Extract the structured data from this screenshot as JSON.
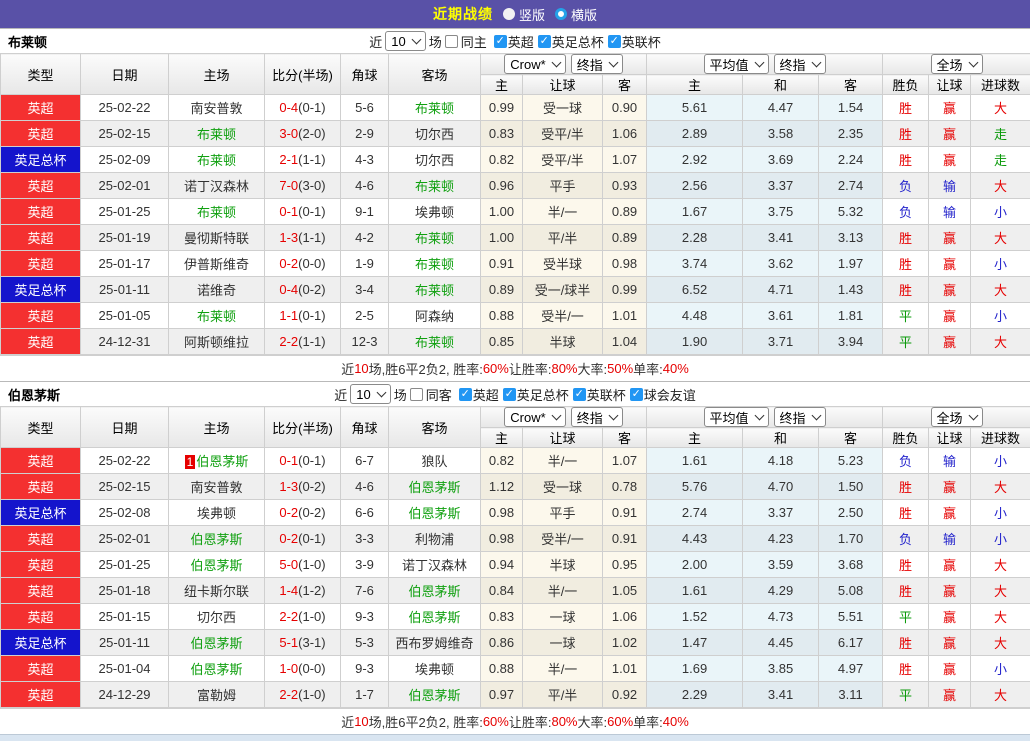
{
  "topbar": {
    "title": "近期战绩",
    "vertical_label": "竖版",
    "horizontal_label": "横版"
  },
  "labels": {
    "near": "近",
    "games": "场",
    "col_type": "类型",
    "col_date": "日期",
    "col_home": "主场",
    "col_score": "比分(半场)",
    "col_corner": "角球",
    "col_away": "客场",
    "col_host": "主",
    "col_handicap": "让球",
    "col_guest": "客",
    "col_draw": "和",
    "col_result": "胜负",
    "col_let": "让球",
    "col_goals": "进球数",
    "sel_crow": "Crow*",
    "sel_final": "终指",
    "sel_avg": "平均值",
    "sel_full": "全场"
  },
  "colors": {
    "topbar_bg": "#5951A7",
    "title_yellow": "#FFFF00",
    "badge_red": "#F43030",
    "badge_blue": "#1414CC",
    "team_green": "#0FA00F",
    "score_red": "#E60000",
    "res_red": "#E60000",
    "res_blue": "#2424CC",
    "res_green": "#089908",
    "checkbox_blue": "#2196F3",
    "radio_ring_blue": "#25A2E8"
  },
  "sections": [
    {
      "team": "布莱顿",
      "filter": {
        "count": "10",
        "same_label": "同主",
        "same_checked": false,
        "leagues": [
          "英超",
          "英足总杯",
          "英联杯"
        ]
      },
      "rows": [
        {
          "lg": "英超",
          "lgc": "red",
          "date": "25-02-22",
          "home": "南安普敦",
          "hg": false,
          "badge": "",
          "score": "0-4",
          "half": "(0-1)",
          "cor": "5-6",
          "away": "布莱顿",
          "ag": true,
          "odds": [
            "0.99",
            "受一球",
            "0.90"
          ],
          "avg": [
            "5.61",
            "4.47",
            "1.54"
          ],
          "res": [
            [
              "胜",
              "r"
            ],
            [
              "赢",
              "r"
            ],
            [
              "大",
              "r"
            ]
          ]
        },
        {
          "lg": "英超",
          "lgc": "red",
          "date": "25-02-15",
          "home": "布莱顿",
          "hg": true,
          "badge": "",
          "score": "3-0",
          "half": "(2-0)",
          "cor": "2-9",
          "away": "切尔西",
          "ag": false,
          "odds": [
            "0.83",
            "受平/半",
            "1.06"
          ],
          "avg": [
            "2.89",
            "3.58",
            "2.35"
          ],
          "res": [
            [
              "胜",
              "r"
            ],
            [
              "赢",
              "r"
            ],
            [
              "走",
              "g"
            ]
          ]
        },
        {
          "lg": "英足总杯",
          "lgc": "blue",
          "date": "25-02-09",
          "home": "布莱顿",
          "hg": true,
          "badge": "",
          "score": "2-1",
          "half": "(1-1)",
          "cor": "4-3",
          "away": "切尔西",
          "ag": false,
          "odds": [
            "0.82",
            "受平/半",
            "1.07"
          ],
          "avg": [
            "2.92",
            "3.69",
            "2.24"
          ],
          "res": [
            [
              "胜",
              "r"
            ],
            [
              "赢",
              "r"
            ],
            [
              "走",
              "g"
            ]
          ]
        },
        {
          "lg": "英超",
          "lgc": "red",
          "date": "25-02-01",
          "home": "诺丁汉森林",
          "hg": false,
          "badge": "",
          "score": "7-0",
          "half": "(3-0)",
          "cor": "4-6",
          "away": "布莱顿",
          "ag": true,
          "odds": [
            "0.96",
            "平手",
            "0.93"
          ],
          "avg": [
            "2.56",
            "3.37",
            "2.74"
          ],
          "res": [
            [
              "负",
              "b"
            ],
            [
              "输",
              "b"
            ],
            [
              "大",
              "r"
            ]
          ]
        },
        {
          "lg": "英超",
          "lgc": "red",
          "date": "25-01-25",
          "home": "布莱顿",
          "hg": true,
          "badge": "",
          "score": "0-1",
          "half": "(0-1)",
          "cor": "9-1",
          "away": "埃弗顿",
          "ag": false,
          "odds": [
            "1.00",
            "半/一",
            "0.89"
          ],
          "avg": [
            "1.67",
            "3.75",
            "5.32"
          ],
          "res": [
            [
              "负",
              "b"
            ],
            [
              "输",
              "b"
            ],
            [
              "小",
              "b"
            ]
          ]
        },
        {
          "lg": "英超",
          "lgc": "red",
          "date": "25-01-19",
          "home": "曼彻斯特联",
          "hg": false,
          "badge": "",
          "score": "1-3",
          "half": "(1-1)",
          "cor": "4-2",
          "away": "布莱顿",
          "ag": true,
          "odds": [
            "1.00",
            "平/半",
            "0.89"
          ],
          "avg": [
            "2.28",
            "3.41",
            "3.13"
          ],
          "res": [
            [
              "胜",
              "r"
            ],
            [
              "赢",
              "r"
            ],
            [
              "大",
              "r"
            ]
          ]
        },
        {
          "lg": "英超",
          "lgc": "red",
          "date": "25-01-17",
          "home": "伊普斯维奇",
          "hg": false,
          "badge": "",
          "score": "0-2",
          "half": "(0-0)",
          "cor": "1-9",
          "away": "布莱顿",
          "ag": true,
          "odds": [
            "0.91",
            "受半球",
            "0.98"
          ],
          "avg": [
            "3.74",
            "3.62",
            "1.97"
          ],
          "res": [
            [
              "胜",
              "r"
            ],
            [
              "赢",
              "r"
            ],
            [
              "小",
              "b"
            ]
          ]
        },
        {
          "lg": "英足总杯",
          "lgc": "blue",
          "date": "25-01-11",
          "home": "诺维奇",
          "hg": false,
          "badge": "",
          "score": "0-4",
          "half": "(0-2)",
          "cor": "3-4",
          "away": "布莱顿",
          "ag": true,
          "odds": [
            "0.89",
            "受一/球半",
            "0.99"
          ],
          "avg": [
            "6.52",
            "4.71",
            "1.43"
          ],
          "res": [
            [
              "胜",
              "r"
            ],
            [
              "赢",
              "r"
            ],
            [
              "大",
              "r"
            ]
          ]
        },
        {
          "lg": "英超",
          "lgc": "red",
          "date": "25-01-05",
          "home": "布莱顿",
          "hg": true,
          "badge": "",
          "score": "1-1",
          "half": "(0-1)",
          "cor": "2-5",
          "away": "阿森纳",
          "ag": false,
          "odds": [
            "0.88",
            "受半/一",
            "1.01"
          ],
          "avg": [
            "4.48",
            "3.61",
            "1.81"
          ],
          "res": [
            [
              "平",
              "g"
            ],
            [
              "赢",
              "r"
            ],
            [
              "小",
              "b"
            ]
          ]
        },
        {
          "lg": "英超",
          "lgc": "red",
          "date": "24-12-31",
          "home": "阿斯顿维拉",
          "hg": false,
          "badge": "",
          "score": "2-2",
          "half": "(1-1)",
          "cor": "12-3",
          "away": "布莱顿",
          "ag": true,
          "odds": [
            "0.85",
            "半球",
            "1.04"
          ],
          "avg": [
            "1.90",
            "3.71",
            "3.94"
          ],
          "res": [
            [
              "平",
              "g"
            ],
            [
              "赢",
              "r"
            ],
            [
              "大",
              "r"
            ]
          ]
        }
      ],
      "summary": [
        [
          "近",
          "k"
        ],
        [
          "10",
          "r"
        ],
        [
          "场,胜6平2负2, 胜率:",
          "k"
        ],
        [
          "60%",
          "r"
        ],
        [
          " 让胜率:",
          "k"
        ],
        [
          "80%",
          "r"
        ],
        [
          " 大率:",
          "k"
        ],
        [
          "50%",
          "r"
        ],
        [
          " 单率:",
          "k"
        ],
        [
          "40%",
          "r"
        ]
      ]
    },
    {
      "team": "伯恩茅斯",
      "filter": {
        "count": "10",
        "same_label": "同客",
        "same_checked": false,
        "leagues": [
          "英超",
          "英足总杯",
          "英联杯",
          "球会友谊"
        ]
      },
      "rows": [
        {
          "lg": "英超",
          "lgc": "red",
          "date": "25-02-22",
          "home": "伯恩茅斯",
          "hg": true,
          "badge": "1",
          "score": "0-1",
          "half": "(0-1)",
          "cor": "6-7",
          "away": "狼队",
          "ag": false,
          "odds": [
            "0.82",
            "半/一",
            "1.07"
          ],
          "avg": [
            "1.61",
            "4.18",
            "5.23"
          ],
          "res": [
            [
              "负",
              "b"
            ],
            [
              "输",
              "b"
            ],
            [
              "小",
              "b"
            ]
          ]
        },
        {
          "lg": "英超",
          "lgc": "red",
          "date": "25-02-15",
          "home": "南安普敦",
          "hg": false,
          "badge": "",
          "score": "1-3",
          "half": "(0-2)",
          "cor": "4-6",
          "away": "伯恩茅斯",
          "ag": true,
          "odds": [
            "1.12",
            "受一球",
            "0.78"
          ],
          "avg": [
            "5.76",
            "4.70",
            "1.50"
          ],
          "res": [
            [
              "胜",
              "r"
            ],
            [
              "赢",
              "r"
            ],
            [
              "大",
              "r"
            ]
          ]
        },
        {
          "lg": "英足总杯",
          "lgc": "blue",
          "date": "25-02-08",
          "home": "埃弗顿",
          "hg": false,
          "badge": "",
          "score": "0-2",
          "half": "(0-2)",
          "cor": "6-6",
          "away": "伯恩茅斯",
          "ag": true,
          "odds": [
            "0.98",
            "平手",
            "0.91"
          ],
          "avg": [
            "2.74",
            "3.37",
            "2.50"
          ],
          "res": [
            [
              "胜",
              "r"
            ],
            [
              "赢",
              "r"
            ],
            [
              "小",
              "b"
            ]
          ]
        },
        {
          "lg": "英超",
          "lgc": "red",
          "date": "25-02-01",
          "home": "伯恩茅斯",
          "hg": true,
          "badge": "",
          "score": "0-2",
          "half": "(0-1)",
          "cor": "3-3",
          "away": "利物浦",
          "ag": false,
          "odds": [
            "0.98",
            "受半/一",
            "0.91"
          ],
          "avg": [
            "4.43",
            "4.23",
            "1.70"
          ],
          "res": [
            [
              "负",
              "b"
            ],
            [
              "输",
              "b"
            ],
            [
              "小",
              "b"
            ]
          ]
        },
        {
          "lg": "英超",
          "lgc": "red",
          "date": "25-01-25",
          "home": "伯恩茅斯",
          "hg": true,
          "badge": "",
          "score": "5-0",
          "half": "(1-0)",
          "cor": "3-9",
          "away": "诺丁汉森林",
          "ag": false,
          "odds": [
            "0.94",
            "半球",
            "0.95"
          ],
          "avg": [
            "2.00",
            "3.59",
            "3.68"
          ],
          "res": [
            [
              "胜",
              "r"
            ],
            [
              "赢",
              "r"
            ],
            [
              "大",
              "r"
            ]
          ]
        },
        {
          "lg": "英超",
          "lgc": "red",
          "date": "25-01-18",
          "home": "纽卡斯尔联",
          "hg": false,
          "badge": "",
          "score": "1-4",
          "half": "(1-2)",
          "cor": "7-6",
          "away": "伯恩茅斯",
          "ag": true,
          "odds": [
            "0.84",
            "半/一",
            "1.05"
          ],
          "avg": [
            "1.61",
            "4.29",
            "5.08"
          ],
          "res": [
            [
              "胜",
              "r"
            ],
            [
              "赢",
              "r"
            ],
            [
              "大",
              "r"
            ]
          ]
        },
        {
          "lg": "英超",
          "lgc": "red",
          "date": "25-01-15",
          "home": "切尔西",
          "hg": false,
          "badge": "",
          "score": "2-2",
          "half": "(1-0)",
          "cor": "9-3",
          "away": "伯恩茅斯",
          "ag": true,
          "odds": [
            "0.83",
            "一球",
            "1.06"
          ],
          "avg": [
            "1.52",
            "4.73",
            "5.51"
          ],
          "res": [
            [
              "平",
              "g"
            ],
            [
              "赢",
              "r"
            ],
            [
              "大",
              "r"
            ]
          ]
        },
        {
          "lg": "英足总杯",
          "lgc": "blue",
          "date": "25-01-11",
          "home": "伯恩茅斯",
          "hg": true,
          "badge": "",
          "score": "5-1",
          "half": "(3-1)",
          "cor": "5-3",
          "away": "西布罗姆维奇",
          "ag": false,
          "odds": [
            "0.86",
            "一球",
            "1.02"
          ],
          "avg": [
            "1.47",
            "4.45",
            "6.17"
          ],
          "res": [
            [
              "胜",
              "r"
            ],
            [
              "赢",
              "r"
            ],
            [
              "大",
              "r"
            ]
          ]
        },
        {
          "lg": "英超",
          "lgc": "red",
          "date": "25-01-04",
          "home": "伯恩茅斯",
          "hg": true,
          "badge": "",
          "score": "1-0",
          "half": "(0-0)",
          "cor": "9-3",
          "away": "埃弗顿",
          "ag": false,
          "odds": [
            "0.88",
            "半/一",
            "1.01"
          ],
          "avg": [
            "1.69",
            "3.85",
            "4.97"
          ],
          "res": [
            [
              "胜",
              "r"
            ],
            [
              "赢",
              "r"
            ],
            [
              "小",
              "b"
            ]
          ]
        },
        {
          "lg": "英超",
          "lgc": "red",
          "date": "24-12-29",
          "home": "富勒姆",
          "hg": false,
          "badge": "",
          "score": "2-2",
          "half": "(1-0)",
          "cor": "1-7",
          "away": "伯恩茅斯",
          "ag": true,
          "odds": [
            "0.97",
            "平/半",
            "0.92"
          ],
          "avg": [
            "2.29",
            "3.41",
            "3.11"
          ],
          "res": [
            [
              "平",
              "g"
            ],
            [
              "赢",
              "r"
            ],
            [
              "大",
              "r"
            ]
          ]
        }
      ],
      "summary": [
        [
          "近",
          "k"
        ],
        [
          "10",
          "r"
        ],
        [
          "场,胜6平2负2, 胜率:",
          "k"
        ],
        [
          "60%",
          "r"
        ],
        [
          " 让胜率:",
          "k"
        ],
        [
          "80%",
          "r"
        ],
        [
          " 大率:",
          "k"
        ],
        [
          "60%",
          "r"
        ],
        [
          " 单率:",
          "k"
        ],
        [
          "40%",
          "r"
        ]
      ]
    }
  ]
}
